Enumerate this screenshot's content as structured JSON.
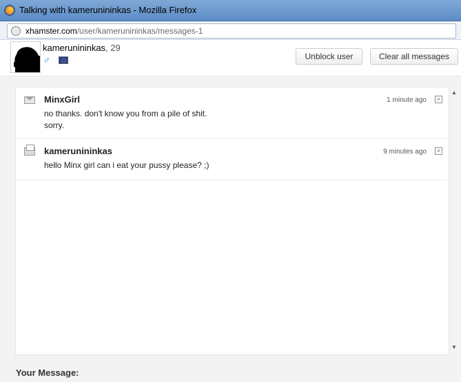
{
  "window": {
    "title": "Talking with kamerunininkas - Mozilla Firefox"
  },
  "address_bar": {
    "host": "xhamster.com",
    "path": "/user/kamerunininkas/messages-1"
  },
  "header": {
    "username": "kamerunininkas",
    "age": ", 29",
    "gender_symbol": "♂",
    "unblock_label": "Unblock user",
    "clear_label": "Clear all messages"
  },
  "messages": [
    {
      "sender": "MinxGirl",
      "text_line1": "no thanks. don't know you from a pile of shit.",
      "text_line2": "sorry.",
      "time": "1 minute ago",
      "icon": "envelope-icon"
    },
    {
      "sender": "kamerunininkas",
      "text_line1": "hello Minx girl can i eat your pussy please? ;)",
      "time": "9 minutes ago",
      "icon": "envelope-open-icon"
    }
  ],
  "compose": {
    "label": "Your Message:"
  }
}
